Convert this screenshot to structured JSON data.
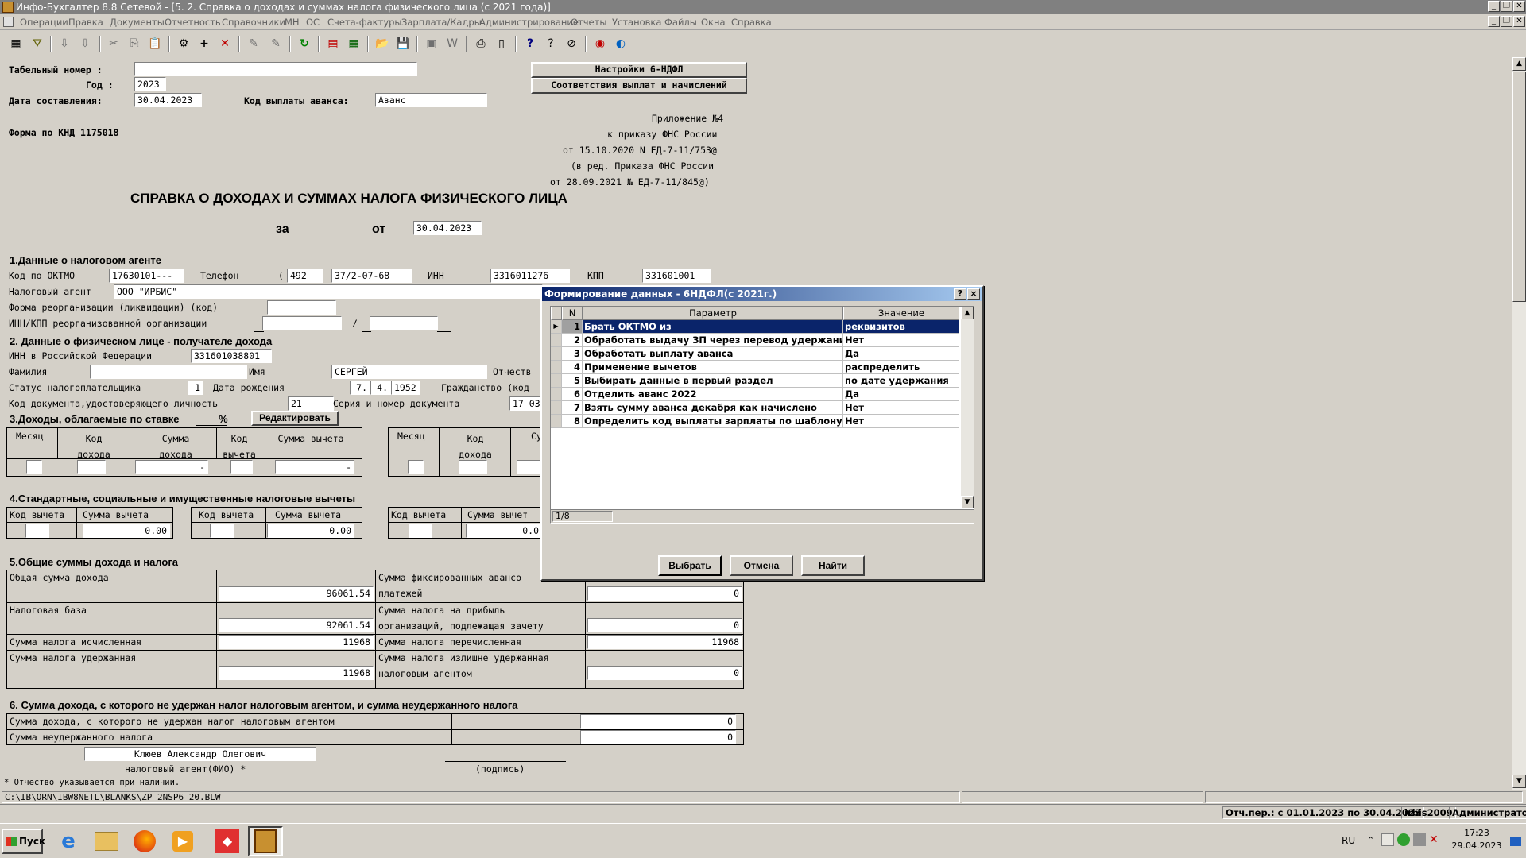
{
  "window": {
    "title": "Инфо-Бухгалтер 8.8 Сетевой - [5. 2. Справка о доходах и суммах налога физического лица (с 2021 года)]"
  },
  "menu": [
    "Операции",
    "Правка",
    "Документы",
    "Отчетность",
    "Справочники",
    "МН",
    "ОС",
    "Счета-фактуры",
    "Зарплата/Кадры",
    "Администрирование",
    "Отчеты",
    "Установка",
    "Файлы",
    "Окна",
    "Справка"
  ],
  "form": {
    "tab_label": "Табельный номер :",
    "tab_value": "",
    "year_label": "Год :",
    "year_value": "2023",
    "date_label": "Дата составления:",
    "date_value": "30.04.2023",
    "advance_label": "Код выплаты аванса:",
    "advance_value": "Аванс",
    "btn_settings": "Настройки 6-НДФЛ",
    "btn_match": "Соответствия выплат и начислений",
    "knd": "Форма по КНД 1175018",
    "appendix": [
      "Приложение №4",
      "к приказу ФНС России",
      "от 15.10.2020 N ЕД-7-11/753@",
      "(в ред. Приказа ФНС России",
      "от 28.09.2021 № ЕД-7-11/845@)"
    ],
    "main_title": "СПРАВКА О ДОХОДАХ И СУММАХ НАЛОГА ФИЗИЧЕСКОГО ЛИЦА",
    "za": "за",
    "ot": "от",
    "title_date": "30.04.2023"
  },
  "section1": {
    "title": "1.Данные о налоговом агенте",
    "oktmo_label": "Код по ОКТМО",
    "oktmo": "17630101---",
    "phone_label": "Телефон",
    "phone_code": "492",
    "phone": "37/2-07-68",
    "inn_label": "ИНН",
    "inn": "3316011276",
    "kpp_label": "КПП",
    "kpp": "331601001",
    "agent_label": "Налоговый агент",
    "agent": "ООО \"ИРБИС\"",
    "reorg_label": "Форма реорганизации (ликвидации) (код)",
    "reorg_inn_label": "ИНН/КПП реорганизованной организации",
    "slash": "/"
  },
  "section2": {
    "title": "2. Данные о физическом лице - получателе дохода",
    "inn_label": "ИНН в Российской Федерации",
    "inn": "331601038801",
    "surname_label": "Фамилия",
    "surname": "",
    "name_label": "Имя",
    "name": "СЕРГЕЙ",
    "patronymic_label": "Отчеств",
    "status_label": "Статус налогоплательщика",
    "status": "1",
    "birth_label": "Дата рождения",
    "birth_d": "7.",
    "birth_m": "4.",
    "birth_y": "1952",
    "citizenship_label": "Гражданство (код",
    "doc_label": "Код документа,удостоверяющего личность",
    "doc_code": "21",
    "doc_series_label": "Серия и номер документа",
    "doc_series": "17 03"
  },
  "section3": {
    "title": "3.Доходы, облагаемые по ставке",
    "percent": "%",
    "edit_btn": "Редактировать",
    "headers": [
      "Месяц",
      "Код дохода",
      "Сумма дохода",
      "Код вычета",
      "Сумма вычета"
    ],
    "headers2": [
      "Месяц",
      "Код дохода",
      "Су"
    ],
    "dash": "-"
  },
  "section4": {
    "title": "4.Стандартные, социальные и имущественные налоговые вычеты",
    "col_code": "Код вычета",
    "col_sum": "Сумма вычета",
    "col_sum_cut": "Сумма вычет",
    "v1": "0.00",
    "v2": "0.00",
    "v3": "0.0"
  },
  "section5": {
    "title": "5.Общие суммы дохода и налога",
    "income_label": "Общая сумма дохода",
    "income": "96061.54",
    "base_label": "Налоговая база",
    "base": "92061.54",
    "calc_label": "Сумма налога исчисленная",
    "calc": "11968",
    "withheld_label": "Сумма налога удержанная",
    "withheld": "11968",
    "fixed_label1": "Сумма фиксированных авансо",
    "fixed_label2": "платежей",
    "fixed": "0",
    "profit_label1": "Сумма налога на прибыль",
    "profit_label2": "организаций, подлежащая зачету",
    "profit": "0",
    "transferred_label": "Сумма налога перечисленная",
    "transferred": "11968",
    "excess_label1": "Сумма налога излишне удержанная",
    "excess_label2": "налоговым агентом",
    "excess": "0"
  },
  "section6": {
    "title": "6. Сумма дохода, с которого не удержан налог налоговым агентом, и сумма неудержанного налога",
    "row1_label": "Сумма дохода, с которого не удержан налог налоговым агентом",
    "row1": "0",
    "row2_label": "Сумма неудержанного налога",
    "row2": "0",
    "agent_name": "Клюев Александр Олегович",
    "agent_caption": "налоговый агент(ФИО)  *",
    "sign_caption": "(подпись)",
    "footnote": "* Отчество указывается при наличии."
  },
  "dialog": {
    "title": "Формирование данных - 6НДФЛ(с 2021г.)",
    "col_n": "N",
    "col_param": "Параметр",
    "col_value": "Значение",
    "rows": [
      {
        "n": "1",
        "param": "Брать ОКТМО из",
        "value": "реквизитов"
      },
      {
        "n": "2",
        "param": "Обработать выдачу ЗП через перевод удержания",
        "value": "Нет"
      },
      {
        "n": "3",
        "param": "Обработать выплату аванса",
        "value": "Да"
      },
      {
        "n": "4",
        "param": "Применение вычетов",
        "value": "распределить"
      },
      {
        "n": "5",
        "param": "Выбирать данные в первый раздел",
        "value": "по дате удержания"
      },
      {
        "n": "6",
        "param": "Отделить аванс 2022",
        "value": "Да"
      },
      {
        "n": "7",
        "param": "Взять сумму аванса декабря как начислено",
        "value": "Нет"
      },
      {
        "n": "8",
        "param": "Определить код выплаты зарплаты по шаблону",
        "value": "Нет"
      }
    ],
    "counter": "1/8",
    "btn_select": "Выбрать",
    "btn_cancel": "Отмена",
    "btn_find": "Найти",
    "help": "?",
    "close": "×"
  },
  "status": {
    "path": "C:\\IB\\ORN\\IBW8NETL\\BLANKS\\ZP_2NSP6_20.BLW",
    "period": "Отч.пер.: с 01.01.2023 по 30.04.2023",
    "db": "irbis2009",
    "user": "Администратор"
  },
  "taskbar": {
    "start": "Пуск",
    "lang": "RU",
    "time": "17:23",
    "date": "29.04.2023"
  },
  "colors": {
    "selection": "#0a246a",
    "title_gradient_start": "#0a246a",
    "face": "#d4d0c8"
  }
}
